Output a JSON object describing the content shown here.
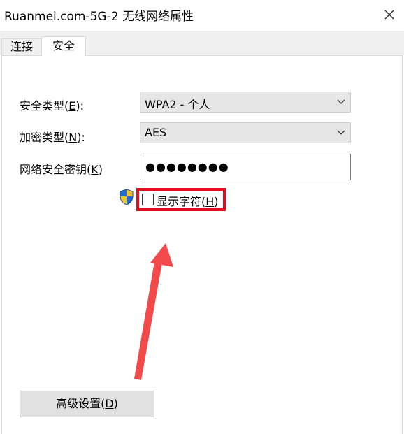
{
  "window": {
    "title": "Ruanmei.com-5G-2 无线网络属性",
    "close_icon": "close-icon"
  },
  "tabs": [
    {
      "label": "连接",
      "active": false
    },
    {
      "label": "安全",
      "active": true
    }
  ],
  "security": {
    "security_type": {
      "label_text": "安全类型",
      "accesskey": "E",
      "value": "WPA2 - 个人"
    },
    "encryption_type": {
      "label_text": "加密类型",
      "accesskey": "N",
      "value": "AES"
    },
    "network_key": {
      "label_text": "网络安全密钥",
      "accesskey": "K",
      "value": "●●●●●●●●"
    },
    "show_chars": {
      "label_text": "显示字符",
      "accesskey": "H",
      "checked": false,
      "icon": "uac-shield-icon"
    }
  },
  "advanced_button": {
    "label_text": "高级设置",
    "accesskey": "D"
  },
  "colors": {
    "highlight": "#e0101f",
    "arrow": "#f24a4a",
    "tab_strip": "#f0f0f0",
    "select_bg": "#e6e6e6",
    "button_bg": "#e1e1e1"
  }
}
